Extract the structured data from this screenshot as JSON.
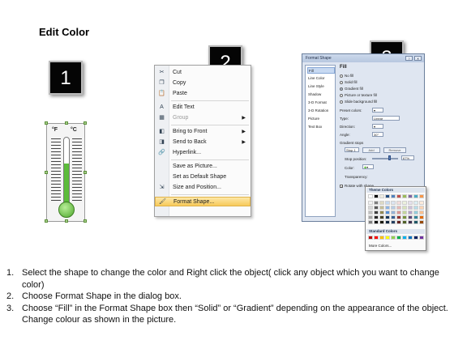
{
  "page_title": "Edit Color",
  "steps": [
    "1",
    "2",
    "3"
  ],
  "thermometer": {
    "unit_f": "°F",
    "unit_c": "°C",
    "fill_level": 0.62,
    "fill_color": "#5cbc3a"
  },
  "context_menu": {
    "items": [
      {
        "label": "Cut",
        "icon": "scissors-icon",
        "glyph": "✂",
        "disabled": false,
        "submenu": false
      },
      {
        "label": "Copy",
        "icon": "copy-icon",
        "glyph": "❐",
        "disabled": false,
        "submenu": false
      },
      {
        "label": "Paste",
        "icon": "paste-icon",
        "glyph": "📋",
        "disabled": false,
        "submenu": false
      },
      {
        "label": "Edit Text",
        "icon": "edit-text-icon",
        "glyph": "A",
        "disabled": false,
        "submenu": false
      },
      {
        "label": "Group",
        "icon": "group-icon",
        "glyph": "▦",
        "disabled": true,
        "submenu": true
      },
      {
        "label": "Bring to Front",
        "icon": "bring-to-front-icon",
        "glyph": "◧",
        "disabled": false,
        "submenu": true
      },
      {
        "label": "Send to Back",
        "icon": "send-to-back-icon",
        "glyph": "◨",
        "disabled": false,
        "submenu": true
      },
      {
        "label": "Hyperlink...",
        "icon": "hyperlink-icon",
        "glyph": "🔗",
        "disabled": false,
        "submenu": false
      },
      {
        "label": "Save as Picture...",
        "icon": "",
        "glyph": "",
        "disabled": false,
        "submenu": false
      },
      {
        "label": "Set as Default Shape",
        "icon": "",
        "glyph": "",
        "disabled": false,
        "submenu": false
      },
      {
        "label": "Size and Position...",
        "icon": "size-position-icon",
        "glyph": "⇲",
        "disabled": false,
        "submenu": false
      },
      {
        "label": "Format Shape...",
        "icon": "format-shape-icon",
        "glyph": "🖌",
        "disabled": false,
        "submenu": false
      }
    ],
    "highlighted": "Format Shape..."
  },
  "dialog": {
    "title": "Format Shape",
    "close_label": "Close",
    "nav_items": [
      "Fill",
      "Line Color",
      "Line Style",
      "Shadow",
      "3-D Format",
      "3-D Rotation",
      "Picture",
      "Text Box"
    ],
    "selected_nav": "Fill",
    "pane_title": "Fill",
    "fill_options": [
      "No fill",
      "Solid fill",
      "Gradient fill",
      "Picture or texture fill",
      "Slide background fill"
    ],
    "selected_fill": "Gradient fill",
    "preset_colors_label": "Preset colors:",
    "type_label": "Type:",
    "type_value": "Linear",
    "direction_label": "Direction:",
    "angle_label": "Angle:",
    "angle_value": "30°",
    "gradient_stops_label": "Gradient stops",
    "stop_value": "Stop 1",
    "add_label": "Add",
    "remove_label": "Remove",
    "stop_position_label": "Stop position:",
    "stop_position_value": "67%",
    "color_label": "Color:",
    "transparency_label": "Transparency:",
    "rotate_label": "Rotate with shape"
  },
  "palette": {
    "theme_colors_label": "Theme Colors",
    "standard_colors_label": "Standard Colors",
    "more_colors_label": "More Colors...",
    "theme_top": [
      "#ffffff",
      "#000000",
      "#eeece1",
      "#1f497d",
      "#4f81bd",
      "#c0504d",
      "#9bbb59",
      "#8064a2",
      "#4bacc6",
      "#f79646"
    ],
    "theme_shades": [
      [
        "#f2f2f2",
        "#7f7f7f",
        "#ddd9c3",
        "#c6d9f0",
        "#dbe5f1",
        "#f2dcdb",
        "#ebf1dd",
        "#e5e0ec",
        "#dbeef3",
        "#fdeada"
      ],
      [
        "#d8d8d8",
        "#595959",
        "#c4bd97",
        "#8db3e2",
        "#b8cce4",
        "#e5b9b7",
        "#d7e3bc",
        "#ccc1d9",
        "#b7dde8",
        "#fbd5b5"
      ],
      [
        "#bfbfbf",
        "#3f3f3f",
        "#938953",
        "#548dd4",
        "#95b3d7",
        "#d99694",
        "#c3d69b",
        "#b2a2c7",
        "#92cddc",
        "#fac08f"
      ],
      [
        "#a5a5a5",
        "#262626",
        "#494429",
        "#17365d",
        "#366092",
        "#953734",
        "#76923c",
        "#5f497a",
        "#31859b",
        "#e36c09"
      ],
      [
        "#7f7f7f",
        "#0c0c0c",
        "#1d1b10",
        "#0f243e",
        "#244061",
        "#632423",
        "#4f6128",
        "#3f3151",
        "#205867",
        "#974806"
      ]
    ],
    "standard": [
      "#c00000",
      "#ff0000",
      "#ffc000",
      "#ffff00",
      "#92d050",
      "#00b050",
      "#00b0f0",
      "#0070c0",
      "#002060",
      "#7030a0"
    ]
  },
  "instructions": [
    {
      "num": "1.",
      "text": "Select the shape to change the color and Right click the object( click any object which you want to change color)"
    },
    {
      "num": "2.",
      "text": "Choose Format Shape in the dialog box."
    },
    {
      "num": "3.",
      "text": "Choose “Fill” in the Format Shape box then “Solid” or “Gradient” depending on the appearance of the object. Change colour as shown in the picture."
    }
  ]
}
